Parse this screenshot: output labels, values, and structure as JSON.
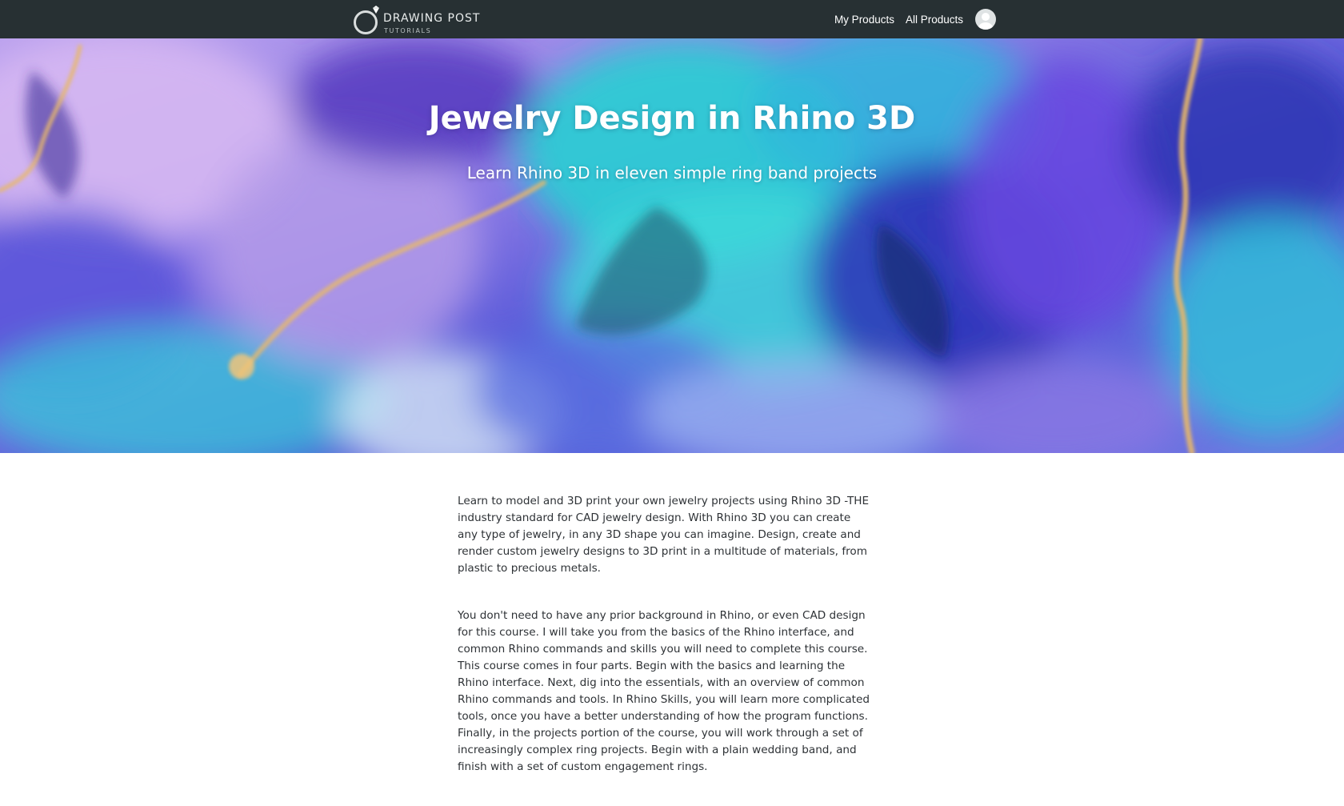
{
  "header": {
    "logo": {
      "name": "DRAWING POST",
      "tagline": "TUTORIALS",
      "icon": "ring-icon"
    },
    "nav": {
      "my_products": "My Products",
      "all_products": "All Products",
      "avatar_icon": "user-avatar-icon"
    },
    "colors": {
      "background": "#273033",
      "text": "#ffffff"
    }
  },
  "hero": {
    "title": "Jewelry Design in Rhino 3D",
    "subtitle": "Learn Rhino 3D in eleven simple ring band projects",
    "colors": {
      "turquoise": "#2ed3d8",
      "violet": "#6a48e0",
      "lavender": "#c0a5f0",
      "gold": "#e8b86a",
      "navy": "#1f2a9a"
    }
  },
  "description": {
    "paragraphs": [
      "Learn to model and 3D print your own jewelry projects using Rhino 3D -THE industry standard for CAD jewelry design. With Rhino 3D you can create any type of jewelry, in any 3D shape you can imagine. Design, create and render custom jewelry designs to 3D print in a multitude of materials, from plastic to precious metals.",
      "You don't need to have any prior background in Rhino, or even CAD design for this course. I will take you from the basics of the Rhino interface, and common Rhino commands and skills you will need to complete this course. This course comes in four parts. Begin with the basics and learning the Rhino interface. Next, dig into the essentials, with an overview of common Rhino commands and tools. In Rhino Skills, you will learn more complicated tools, once you have a better understanding of how the program functions. Finally, in the projects portion of the course, you will work through a set of increasingly complex ring projects. Begin with a plain wedding band, and finish with a set of custom en­gagement rings."
    ]
  }
}
